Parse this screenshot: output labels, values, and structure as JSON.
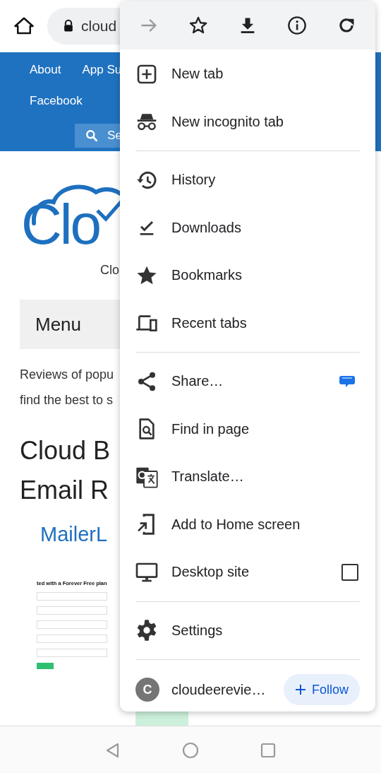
{
  "address_bar": {
    "url": "cloud"
  },
  "site_nav": {
    "links": [
      "About",
      "App Su",
      "Facebook"
    ],
    "search_placeholder": "Se"
  },
  "logo": {
    "text": "Clo",
    "tagline": "Clo"
  },
  "menu_button": "Menu",
  "intro": [
    "Reviews of popu",
    "find the best to s"
  ],
  "heading": [
    "Cloud B",
    "Email R"
  ],
  "subheading": "MailerL",
  "screenshot": {
    "title": "ted with a Forever Free plan"
  },
  "browser_menu": {
    "toolbar": [
      {
        "kind": "forward",
        "disabled": true
      },
      {
        "kind": "bookmark",
        "disabled": false
      },
      {
        "kind": "download",
        "disabled": false
      },
      {
        "kind": "info",
        "disabled": false
      },
      {
        "kind": "reload",
        "disabled": false
      }
    ],
    "items": [
      {
        "kind": "new-tab",
        "label": "New tab"
      },
      {
        "kind": "incognito",
        "label": "New incognito tab"
      },
      {
        "kind": "divider"
      },
      {
        "kind": "history",
        "label": "History"
      },
      {
        "kind": "downloads",
        "label": "Downloads"
      },
      {
        "kind": "bookmarks",
        "label": "Bookmarks"
      },
      {
        "kind": "recent-tabs",
        "label": "Recent tabs"
      },
      {
        "kind": "divider"
      },
      {
        "kind": "share",
        "label": "Share…",
        "badge": true
      },
      {
        "kind": "find",
        "label": "Find in page"
      },
      {
        "kind": "translate",
        "label": "Translate…"
      },
      {
        "kind": "add-home",
        "label": "Add to Home screen"
      },
      {
        "kind": "desktop",
        "label": "Desktop site",
        "checked": false
      },
      {
        "kind": "divider"
      },
      {
        "kind": "settings",
        "label": "Settings"
      }
    ],
    "account": {
      "initial": "C",
      "name": "cloudeerevie…",
      "follow": "Follow"
    }
  }
}
